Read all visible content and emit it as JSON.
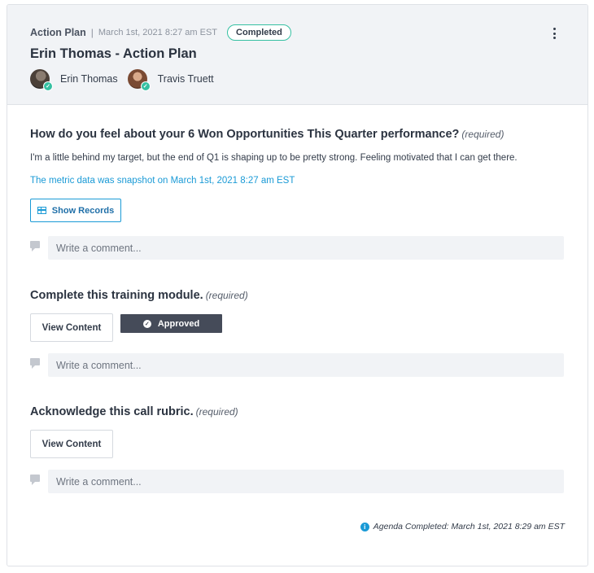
{
  "header": {
    "breadcrumb_title": "Action Plan",
    "separator": "|",
    "date": "March 1st, 2021 8:27 am EST",
    "status": "Completed",
    "title": "Erin Thomas - Action Plan",
    "participants": [
      {
        "name": "Erin Thomas"
      },
      {
        "name": "Travis Truett"
      }
    ],
    "menu_icon": "kebab-menu-icon"
  },
  "questions": [
    {
      "title": "How do you feel about your 6 Won Opportunities This Quarter performance?",
      "required": "(required)",
      "answer": "I'm a little behind my target, but the end of Q1 is shaping up to be pretty strong. Feeling motivated that I can get there.",
      "snapshot_note": "The metric data was snapshot on March 1st, 2021 8:27 am EST",
      "button_label": "Show Records",
      "comment_placeholder": "Write a comment..."
    },
    {
      "title": "Complete this training module.",
      "required": "(required)",
      "button_label": "View Content",
      "badge": "Approved",
      "comment_placeholder": "Write a comment..."
    },
    {
      "title": "Acknowledge this call rubric.",
      "required": "(required)",
      "button_label": "View Content",
      "comment_placeholder": "Write a comment..."
    }
  ],
  "footer": {
    "completed_text": "Agenda Completed: March 1st, 2021 8:29 am EST"
  },
  "colors": {
    "accent": "#1a9ad6",
    "success": "#35c0a2",
    "badge_dark": "#454b59"
  }
}
